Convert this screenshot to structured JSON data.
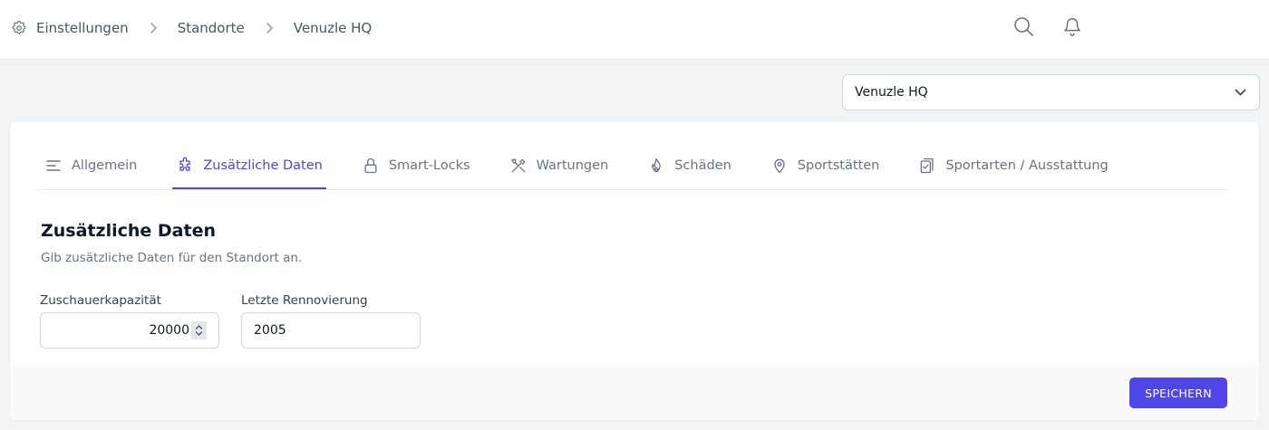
{
  "breadcrumb": {
    "icon": "gear-icon",
    "items": [
      "Einstellungen",
      "Standorte",
      "Venuzle HQ"
    ]
  },
  "header": {
    "icons": [
      "search-icon",
      "bell-icon"
    ]
  },
  "location_select": {
    "value": "Venuzle HQ"
  },
  "tabs": [
    {
      "label": "Allgemein",
      "icon": "menu-lines-icon",
      "active": false
    },
    {
      "label": "Zusätzliche Daten",
      "icon": "puzzle-icon",
      "active": true
    },
    {
      "label": "Smart-Locks",
      "icon": "lock-icon",
      "active": false
    },
    {
      "label": "Wartungen",
      "icon": "tools-icon",
      "active": false
    },
    {
      "label": "Schäden",
      "icon": "fire-icon",
      "active": false
    },
    {
      "label": "Sportstätten",
      "icon": "location-pin-icon",
      "active": false
    },
    {
      "label": "Sportarten / Ausstattung",
      "icon": "clipboard-check-icon",
      "active": false
    }
  ],
  "section": {
    "title": "Zusätzliche Daten",
    "description": "Gib zusätzliche Daten für den Standort an."
  },
  "fields": {
    "capacity": {
      "label": "Zuschauerkapazität",
      "value": "20000"
    },
    "renovation": {
      "label": "Letzte Rennovierung",
      "value": "2005"
    }
  },
  "footer": {
    "save_label": "SPEICHERN"
  },
  "colors": {
    "accent": "#4f46e5",
    "background": "#f3f4f6"
  }
}
